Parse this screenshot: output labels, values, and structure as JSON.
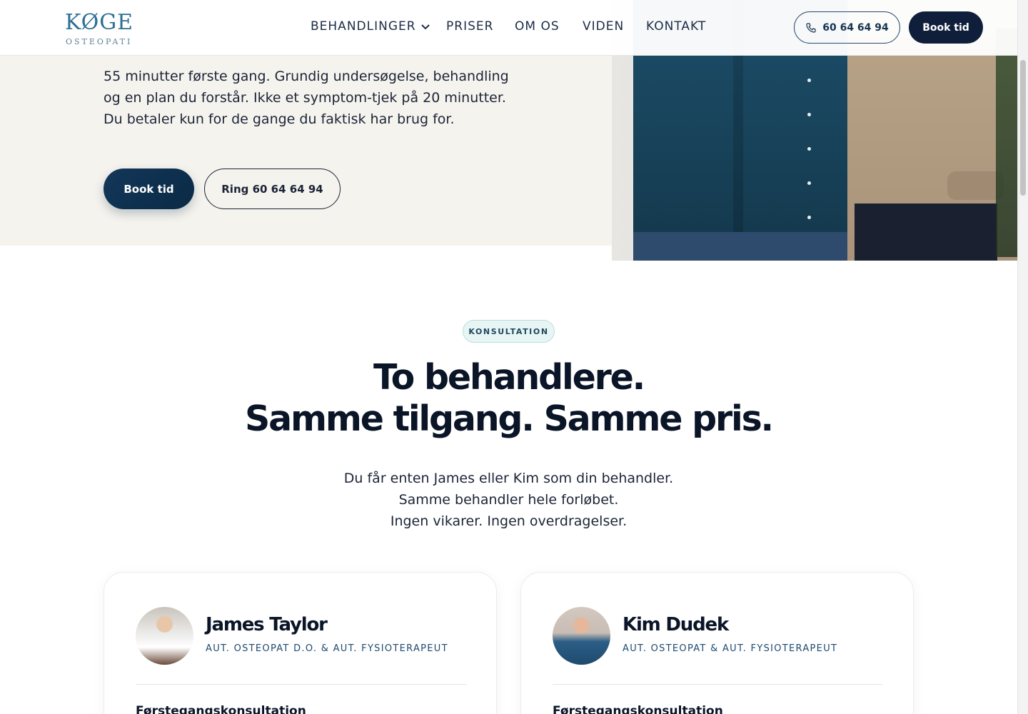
{
  "header": {
    "logo_main": "KØGE",
    "logo_sub": "OSTEOPATI",
    "nav": [
      "BEHANDLINGER",
      "PRISER",
      "OM OS",
      "VIDEN",
      "KONTAKT"
    ],
    "phone": "60 64 64 94",
    "book": "Book tid"
  },
  "hero": {
    "text_lines": [
      "55 minutter første gang. Grundig undersøgelse, behandling",
      "og en plan du forstår. Ikke et symptom-tjek på 20 minutter.",
      "Du betaler kun for de gange du faktisk har brug for."
    ],
    "cta_book": "Book tid",
    "cta_ring": "Ring 60 64 64 94"
  },
  "section": {
    "badge": "KONSULTATION",
    "title_lines": [
      "To behandlere.",
      "Samme tilgang. Samme pris."
    ],
    "sub_lines": [
      "Du får enten James eller Kim som din behandler.",
      "Samme behandler hele forløbet.",
      "Ingen vikarer. Ingen overdragelser."
    ]
  },
  "cards": [
    {
      "name": "James Taylor",
      "role": "AUT. OSTEOPAT D.O. & AUT. FYSIOTERAPEUT",
      "first": "Førstegangskonsultation"
    },
    {
      "name": "Kim Dudek",
      "role": "AUT. OSTEOPAT & AUT. FYSIOTERAPEUT",
      "first": "Førstegangskonsultation"
    }
  ],
  "colors": {
    "navy": "#0f1e3a",
    "accent": "#2e6f93",
    "hero_bg": "#f5f3ee",
    "badge_bg": "#e8f5f5"
  }
}
